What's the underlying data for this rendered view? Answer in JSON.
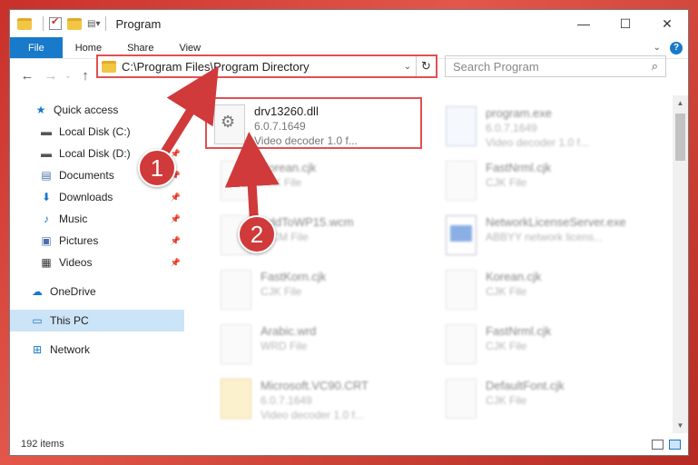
{
  "window": {
    "title": "Program",
    "controls": {
      "minimize": "—",
      "maximize": "☐",
      "close": "✕"
    }
  },
  "ribbon": {
    "tabs": [
      "File",
      "Home",
      "Share",
      "View"
    ],
    "help": "?"
  },
  "address_bar": {
    "path": "C:\\Program Files\\Program Directory"
  },
  "search": {
    "placeholder": "Search Program"
  },
  "sidebar": {
    "items": [
      {
        "label": "Quick access",
        "icon": "star-icon"
      },
      {
        "label": "Local Disk (C:)",
        "icon": "drive-icon"
      },
      {
        "label": "Local Disk (D:)",
        "icon": "drive-icon"
      },
      {
        "label": "Documents",
        "icon": "documents-icon"
      },
      {
        "label": "Downloads",
        "icon": "download-icon"
      },
      {
        "label": "Music",
        "icon": "music-icon"
      },
      {
        "label": "Pictures",
        "icon": "pictures-icon"
      },
      {
        "label": "Videos",
        "icon": "videos-icon"
      },
      {
        "label": "OneDrive",
        "icon": "cloud-icon"
      },
      {
        "label": "This PC",
        "icon": "computer-icon"
      },
      {
        "label": "Network",
        "icon": "network-icon"
      }
    ]
  },
  "files": {
    "selected": {
      "name": "drv13260.dll",
      "line2": "6.0.7.1649",
      "line3": "Video decoder 1.0 f..."
    },
    "others": [
      {
        "name": "program.exe",
        "line2": "6.0.7.1649",
        "line3": "Video decoder 1.0 f..."
      },
      {
        "name": "Korean.cjk",
        "line2": "CJK File",
        "line3": ""
      },
      {
        "name": "FastNrml.cjk",
        "line2": "CJK File",
        "line3": ""
      },
      {
        "name": "AddToWP15.wcm",
        "line2": "WCM File",
        "line3": ""
      },
      {
        "name": "NetworkLicenseServer.exe",
        "line2": "ABBYY network licens...",
        "line3": ""
      },
      {
        "name": "FastKorn.cjk",
        "line2": "CJK File",
        "line3": ""
      },
      {
        "name": "Korean.cjk",
        "line2": "CJK File",
        "line3": ""
      },
      {
        "name": "Arabic.wrd",
        "line2": "WRD File",
        "line3": ""
      },
      {
        "name": "FastNrml.cjk",
        "line2": "CJK File",
        "line3": ""
      },
      {
        "name": "Microsoft.VC90.CRT",
        "line2": "6.0.7.1649",
        "line3": "Video decoder 1.0 f..."
      },
      {
        "name": "DefaultFont.cjk",
        "line2": "CJK File",
        "line3": ""
      }
    ]
  },
  "status": {
    "item_count": "192 items"
  },
  "annotations": {
    "step1": "1",
    "step2": "2",
    "arrow_color": "#d03a3a"
  }
}
